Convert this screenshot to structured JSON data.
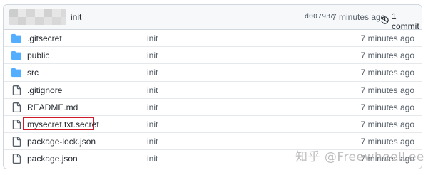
{
  "commit": {
    "message": "init",
    "sha": "d00793c",
    "ago": "7 minutes ago",
    "history_label": "1 commit"
  },
  "files": [
    {
      "name": ".gitsecret",
      "type": "folder",
      "message": "init",
      "time": "7 minutes ago",
      "highlighted": false
    },
    {
      "name": "public",
      "type": "folder",
      "message": "init",
      "time": "7 minutes ago",
      "highlighted": false
    },
    {
      "name": "src",
      "type": "folder",
      "message": "init",
      "time": "7 minutes ago",
      "highlighted": false
    },
    {
      "name": ".gitignore",
      "type": "file",
      "message": "init",
      "time": "7 minutes ago",
      "highlighted": false
    },
    {
      "name": "README.md",
      "type": "file",
      "message": "init",
      "time": "7 minutes ago",
      "highlighted": false
    },
    {
      "name": "mysecret.txt.secret",
      "type": "file",
      "message": "init",
      "time": "7 minutes ago",
      "highlighted": true
    },
    {
      "name": "package-lock.json",
      "type": "file",
      "message": "init",
      "time": "7 minutes ago",
      "highlighted": false
    },
    {
      "name": "package.json",
      "type": "file",
      "message": "init",
      "time": "7 minutes ago",
      "highlighted": false
    }
  ],
  "colors": {
    "folder": "#54aeff",
    "file": "#57606a",
    "highlight": "#d11a2a"
  },
  "watermark": "知乎 @FreewheelLee"
}
